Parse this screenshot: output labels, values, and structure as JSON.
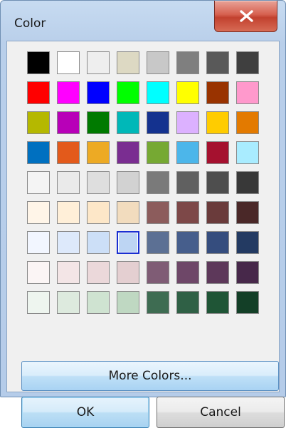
{
  "window": {
    "title": "Color"
  },
  "palette": [
    [
      "#000000",
      "#ffffff",
      "#eeeeee",
      "#ddd9c3",
      "#c8c8c8",
      "#7f7f7f",
      "#595959",
      "#3f3f3f"
    ],
    [
      "#ff0000",
      "#ff00ff",
      "#0000ff",
      "#00ff00",
      "#00ffff",
      "#ffff00",
      "#993300",
      "#ff99cc"
    ],
    [
      "#b5b800",
      "#b800b8",
      "#007a00",
      "#00b8b8",
      "#14328f",
      "#dcb1ff",
      "#ffcc00",
      "#e37a00"
    ],
    [
      "#0070c0",
      "#e35a1b",
      "#edaa24",
      "#7a2d91",
      "#76a933",
      "#4cb6ea",
      "#a5112f",
      "#a9ecff"
    ],
    [
      "#f4f4f4",
      "#eaeaea",
      "#dedede",
      "#d2d2d2",
      "#7a7a7a",
      "#606060",
      "#4e4e4e",
      "#383838"
    ],
    [
      "#fff5e8",
      "#ffefd8",
      "#fde7c8",
      "#f2dcbe",
      "#8c5c5c",
      "#7d4848",
      "#6a3b3b",
      "#4a2828"
    ],
    [
      "#f2f6ff",
      "#dde9fb",
      "#ccdff7",
      "#bdd5f3",
      "#5c7094",
      "#465e8c",
      "#354d7e",
      "#233a62"
    ],
    [
      "#fbf5f5",
      "#f3e5e6",
      "#ebd8da",
      "#e4cfd1",
      "#7f5c75",
      "#6e4768",
      "#5d385a",
      "#47284a"
    ],
    [
      "#eef5ef",
      "#ddeade",
      "#cfe3d1",
      "#bfd8c2",
      "#3e6c52",
      "#2f6045",
      "#1f5536",
      "#133f27"
    ]
  ],
  "selected": {
    "row": 6,
    "col": 3
  },
  "buttons": {
    "more_colors": "More Colors...",
    "ok": "OK",
    "cancel": "Cancel"
  },
  "icons": {
    "close": "close-x-icon"
  }
}
